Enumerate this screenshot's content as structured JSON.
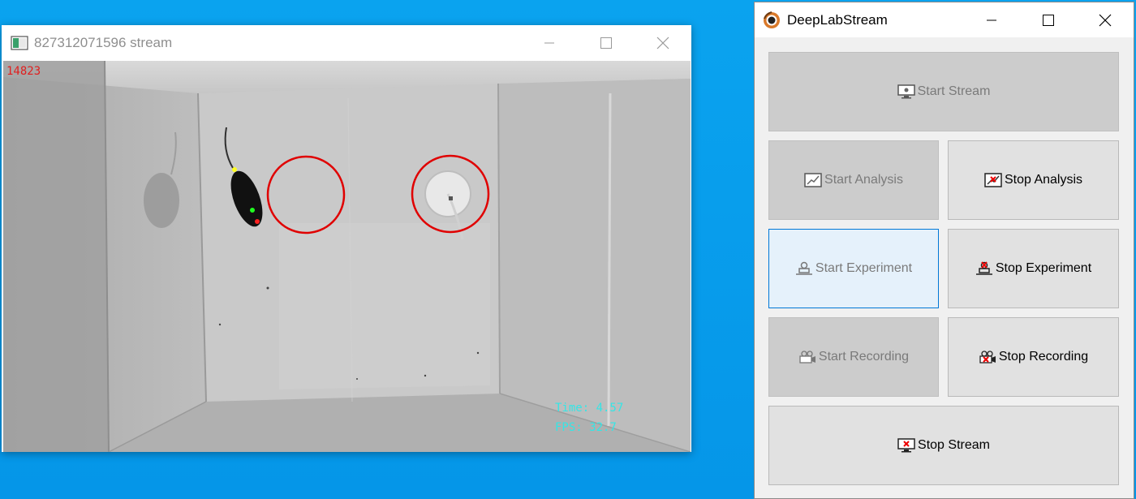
{
  "stream_window": {
    "title": "827312071596 stream",
    "frame_counter": "14823",
    "time_text": "Time: 4.57",
    "fps_text": "FPS: 32.7"
  },
  "control_window": {
    "title": "DeepLabStream",
    "buttons": {
      "start_stream": "Start Stream",
      "start_analysis": "Start Analysis",
      "stop_analysis": "Stop Analysis",
      "start_experiment": "Start Experiment",
      "stop_experiment": "Stop Experiment",
      "start_recording": "Start Recording",
      "stop_recording": "Stop Recording",
      "stop_stream": "Stop Stream"
    }
  },
  "colors": {
    "desktop": "#0596e8",
    "roi_circle": "#e00000",
    "overlay_text": "#34e6e6",
    "frame_counter": "#e02020",
    "keypoint_nose": "#ffff20",
    "keypoint_neck": "#20ff20",
    "keypoint_tail": "#ff2020"
  },
  "icons": [
    "stream-app-icon",
    "minimize-icon",
    "maximize-icon",
    "close-icon",
    "deeplabstream-logo-icon",
    "monitor-icon",
    "analysis-icon",
    "experiment-icon",
    "camera-icon"
  ]
}
